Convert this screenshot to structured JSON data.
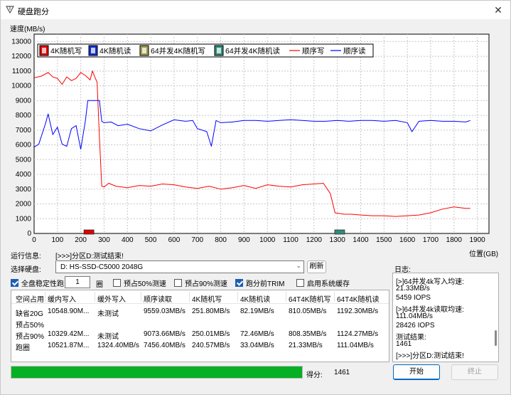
{
  "window": {
    "title": "硬盘跑分",
    "close_icon": "✕"
  },
  "chart": {
    "y_label": "速度(MB/s)",
    "x_label": "位置(GB)",
    "y_ticks": [
      "13000",
      "12000",
      "11000",
      "10000",
      "9000",
      "8000",
      "7000",
      "6000",
      "5000",
      "4000",
      "3000",
      "2000",
      "1000",
      "0"
    ],
    "x_ticks": [
      "0",
      "100",
      "200",
      "300",
      "400",
      "500",
      "600",
      "700",
      "800",
      "900",
      "1000",
      "1100",
      "1200",
      "1300",
      "1400",
      "1500",
      "1600",
      "1700",
      "1800",
      "1900"
    ],
    "legend": [
      "4K随机写",
      "4K随机读",
      "64并发4K随机写",
      "64并发4K随机读",
      "顺序写",
      "顺序读"
    ]
  },
  "chart_data": {
    "type": "line",
    "x_range": [
      0,
      1950
    ],
    "ylim": [
      0,
      13500
    ],
    "grid": true,
    "legend_position": "top-left",
    "series": [
      {
        "name": "顺序写",
        "color": "#ff0000",
        "x": [
          0,
          30,
          60,
          80,
          100,
          120,
          140,
          160,
          180,
          200,
          220,
          240,
          250,
          260,
          270,
          280,
          290,
          300,
          320,
          350,
          400,
          450,
          500,
          550,
          600,
          650,
          700,
          750,
          800,
          850,
          900,
          950,
          1000,
          1050,
          1100,
          1150,
          1200,
          1240,
          1270,
          1290,
          1310,
          1330,
          1360,
          1400,
          1450,
          1500,
          1550,
          1600,
          1650,
          1700,
          1750,
          1800,
          1850,
          1870
        ],
        "y": [
          10550,
          10650,
          10900,
          10600,
          10500,
          10100,
          10600,
          10350,
          10500,
          10900,
          10700,
          10400,
          11000,
          10600,
          10250,
          6500,
          3200,
          3150,
          3400,
          3200,
          3100,
          3250,
          3200,
          3350,
          3300,
          3150,
          3050,
          3200,
          3000,
          3100,
          3250,
          3050,
          3300,
          3200,
          3150,
          3300,
          3350,
          3400,
          2700,
          1400,
          1350,
          1300,
          1300,
          1250,
          1200,
          1200,
          1150,
          1200,
          1250,
          1400,
          1650,
          1800,
          1700,
          1700
        ]
      },
      {
        "name": "顺序读",
        "color": "#0000ff",
        "x": [
          0,
          20,
          50,
          60,
          80,
          100,
          120,
          140,
          160,
          180,
          200,
          220,
          230,
          240,
          260,
          280,
          290,
          300,
          330,
          360,
          400,
          450,
          500,
          550,
          600,
          650,
          680,
          700,
          740,
          760,
          780,
          800,
          850,
          900,
          950,
          1000,
          1050,
          1100,
          1150,
          1200,
          1250,
          1300,
          1350,
          1400,
          1450,
          1500,
          1550,
          1600,
          1620,
          1650,
          1700,
          1750,
          1800,
          1850,
          1870
        ],
        "y": [
          5850,
          6050,
          7500,
          8100,
          6700,
          7200,
          6050,
          5900,
          7100,
          7300,
          5700,
          7650,
          9000,
          9000,
          9000,
          9000,
          7600,
          7500,
          7550,
          7300,
          7400,
          7100,
          6950,
          7350,
          7700,
          7600,
          7650,
          7100,
          6900,
          5900,
          7650,
          7500,
          7550,
          7650,
          7650,
          7600,
          7650,
          7700,
          7650,
          7600,
          7600,
          7650,
          7600,
          7650,
          7650,
          7600,
          7650,
          7500,
          6900,
          7600,
          7650,
          7600,
          7600,
          7550,
          7650
        ]
      }
    ],
    "markers": [
      {
        "series": "4K随机写",
        "x": 235,
        "y": 0
      },
      {
        "series": "64并发4K随机读",
        "x": 1310,
        "y": 0
      }
    ]
  },
  "status": {
    "label": "运行信息:",
    "text": "[>>>]分区D:测试结束!"
  },
  "disk": {
    "label": "选择硬盘:",
    "value": "D:  HS-SSD-C5000 2048G",
    "refresh": "刷新"
  },
  "options": {
    "full_disk_stable": "全盘稳定性跑",
    "full_disk_stable_checked": true,
    "rounds_value": "1",
    "rounds_unit": "圈",
    "prefill50": "预占50%测速",
    "prefill50_checked": false,
    "prefill90": "预占90%测速",
    "prefill90_checked": false,
    "trim": "跑分前TRIM",
    "trim_checked": true,
    "sys_cache": "启用系统缓存",
    "sys_cache_checked": false
  },
  "table": {
    "headers": [
      "空间占用",
      "缓内写入",
      "缓外写入",
      "顺序读取",
      "4K随机写",
      "4K随机读",
      "64T4K随机写",
      "64T4K随机读"
    ],
    "rows": [
      [
        "缺省20G",
        "10548.90M...",
        "未测试",
        "9559.03MB/s",
        "251.80MB/s",
        "82.19MB/s",
        "810.05MB/s",
        "1192.30MB/s"
      ],
      [
        "预占50%",
        "",
        "",
        "",
        "",
        "",
        "",
        ""
      ],
      [
        "预占90%",
        "10329.42M...",
        "未测试",
        "9073.66MB/s",
        "250.01MB/s",
        "72.46MB/s",
        "808.35MB/s",
        "1124.27MB/s"
      ],
      [
        "跑圈",
        "10521.87M...",
        "1324.40MB/s",
        "7456.40MB/s",
        "240.57MB/s",
        "33.04MB/s",
        "21.33MB/s",
        "111.04MB/s"
      ]
    ]
  },
  "log": {
    "label": "日志:",
    "lines": [
      "[>]64并发4k写入均速:",
      "21.33MB/s",
      "5459 IOPS",
      "[>]64并发4k读取均速:",
      "111.04MB/s",
      "28426 IOPS",
      "测试结果:",
      "1461",
      "[>>>]分区D:测试结束!"
    ]
  },
  "progress": {
    "value": 1.0,
    "color": "#06b025"
  },
  "score": {
    "label": "得分:",
    "value": "1461"
  },
  "buttons": {
    "start": "开始",
    "stop": "终止"
  }
}
